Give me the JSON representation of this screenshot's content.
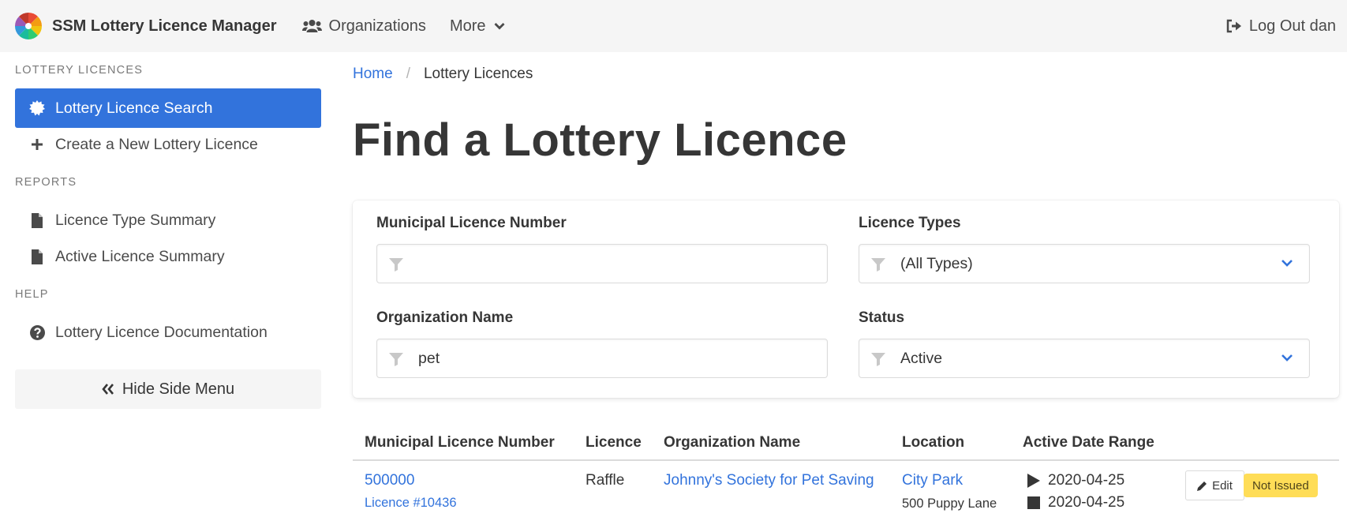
{
  "app": {
    "title": "SSM Lottery Licence Manager",
    "logo_icon": "ssm-logo-icon"
  },
  "nav": {
    "organizations_label": "Organizations",
    "more_label": "More",
    "logout_label": "Log Out dan"
  },
  "sidebar": {
    "sections": [
      {
        "label": "LOTTERY LICENCES"
      },
      {
        "label": "REPORTS"
      },
      {
        "label": "HELP"
      }
    ],
    "items": [
      {
        "label": "Lottery Licence Search",
        "icon": "certificate-icon",
        "active": true
      },
      {
        "label": "Create a New Lottery Licence",
        "icon": "plus-icon"
      },
      {
        "label": "Licence Type Summary",
        "icon": "file-icon"
      },
      {
        "label": "Active Licence Summary",
        "icon": "file-icon"
      },
      {
        "label": "Lottery Licence Documentation",
        "icon": "question-circle-icon"
      }
    ],
    "hide_label": "Hide Side Menu"
  },
  "breadcrumb": {
    "home": "Home",
    "current": "Lottery Licences"
  },
  "page_title": "Find a Lottery Licence",
  "filters": {
    "licence_number": {
      "label": "Municipal Licence Number",
      "value": ""
    },
    "licence_types": {
      "label": "Licence Types",
      "value": "(All Types)"
    },
    "organization_name": {
      "label": "Organization Name",
      "value": "pet"
    },
    "status": {
      "label": "Status",
      "value": "Active"
    }
  },
  "table": {
    "headers": [
      "Municipal Licence Number",
      "Licence",
      "Organization Name",
      "Location",
      "Active Date Range"
    ],
    "rows": [
      {
        "licence_number": "500000",
        "licence_id": "Licence #10436",
        "licence_type": "Raffle",
        "organization": "Johnny's Society for Pet Saving",
        "location_name": "City Park",
        "location_address": "500 Puppy Lane",
        "start_date": "2020-04-25",
        "end_date": "2020-04-25",
        "edit_label": "Edit",
        "status_tag": "Not Issued"
      }
    ]
  },
  "colors": {
    "primary": "#3273dc",
    "warning": "#ffdd57",
    "navbar": "#f5f5f5"
  }
}
